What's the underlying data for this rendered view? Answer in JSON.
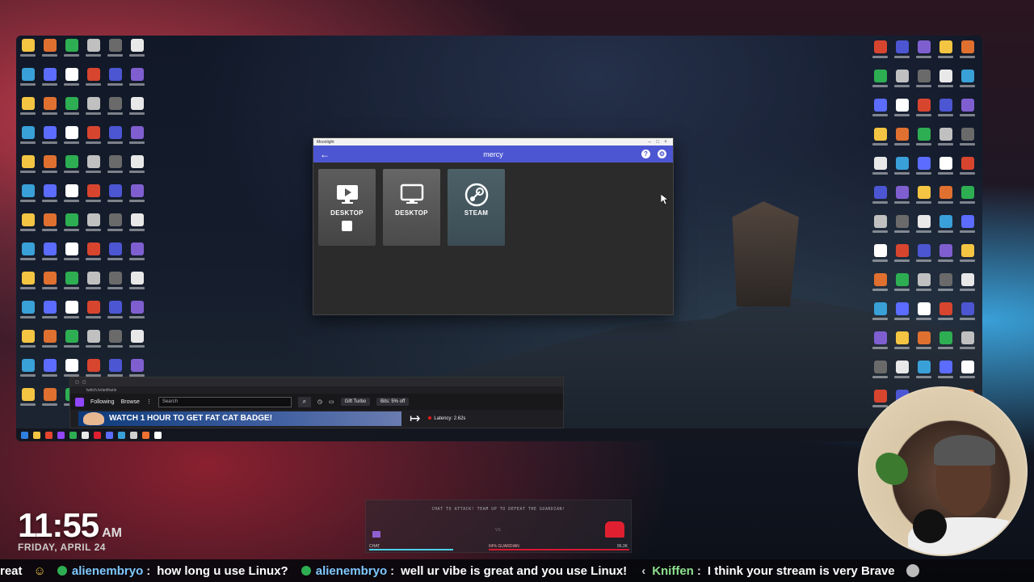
{
  "moonlight": {
    "window_title": "Moonlight",
    "host_name": "mercy",
    "apps": [
      {
        "label": "DESKTOP",
        "icon": "play-icon",
        "running": true
      },
      {
        "label": "DESKTOP",
        "icon": "monitor-icon",
        "running": false
      },
      {
        "label": "STEAM",
        "icon": "steam-icon",
        "running": false
      }
    ],
    "accent": "#4c56d2"
  },
  "browser": {
    "url": "twitch.tv/antharis",
    "nav": {
      "following": "Following",
      "browse": "Browse",
      "search_placeholder": "Search",
      "gift_turbo": "Gift Turbo",
      "bits_offer": "Bits: 5% off"
    },
    "banner_text": "WATCH 1 HOUR TO GET FAT CAT BADGE!",
    "latency": "Latency: 2.62s"
  },
  "clock": {
    "time": "11:55",
    "ampm": "AM",
    "date": "FRIDAY, APRIL 24"
  },
  "game_overlay": {
    "title": "CHAT TO ATTACK! TEAM UP TO DEFEAT THE GUARDIAN!",
    "vs": "VS",
    "chat_label": "CHAT",
    "guardian_label": "64% GUARDIAN",
    "hp_value": "96.3K"
  },
  "ticker": {
    "start_fragment": "reat",
    "messages": [
      {
        "user": "alienembryo",
        "text": "how long u use Linux?"
      },
      {
        "user": "alienembryo",
        "text": "well ur vibe is great and you use Linux!"
      },
      {
        "user": "Kniffen",
        "text": "I think your stream is very Brave"
      }
    ]
  }
}
